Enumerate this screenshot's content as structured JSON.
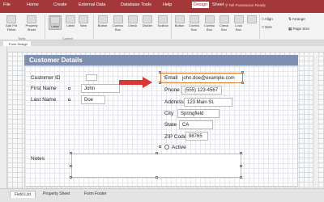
{
  "menu": {
    "file": "File",
    "home": "Home",
    "create": "Create",
    "external": "External Data",
    "dbtools": "Database Tools",
    "help": "Help",
    "design": "Design",
    "sheet": "Sheet",
    "tell": "Tell Possession Ready"
  },
  "ribbon": {
    "add_field": "Add Fld Fields",
    "property_sheet": "Property Sheet",
    "tools_label": "Tools",
    "label_btn": "Label",
    "label2": "Label",
    "new": "New",
    "button": "Button",
    "combo": "Combo Box",
    "check": "Check",
    "divider": "Divider",
    "toolbox": "Toolbox",
    "combo_box": "Combo Box",
    "check_box": "Check Box",
    "list_box": "Lock Box",
    "controls_label": "Control",
    "arrange": "Arrange",
    "page_size": "Page Size",
    "opt1": "Align",
    "opt2": "Size"
  },
  "form": {
    "tab_label": "Form Design",
    "header_title": "Customer Details",
    "customer_id_label": "Customer ID",
    "customer_id_value": "",
    "first_name_label": "First Name",
    "first_name_value": "John",
    "last_name_label": "Last Name",
    "last_name_value": "Doe",
    "email_label": "Email",
    "email_value": "john.doe@example.com",
    "phone_label": "Phone",
    "phone_value": "(555) 123-4567",
    "address_label": "Address",
    "address_value": "123 Main St.",
    "city_label": "City",
    "city_value": "Springfield",
    "state_label": "State",
    "state_value": "CA",
    "zip_label": "ZIP Code",
    "zip_value": "98765",
    "active_label": "Active",
    "notes_label": "Notes"
  },
  "bottom_tabs": [
    "Field List",
    "Property Sheet",
    "Form Footer"
  ],
  "colors": {
    "brand": "#a4373a",
    "header": "#7f8fb0",
    "arrow": "#d63a32",
    "selection": "#e07a2a"
  }
}
